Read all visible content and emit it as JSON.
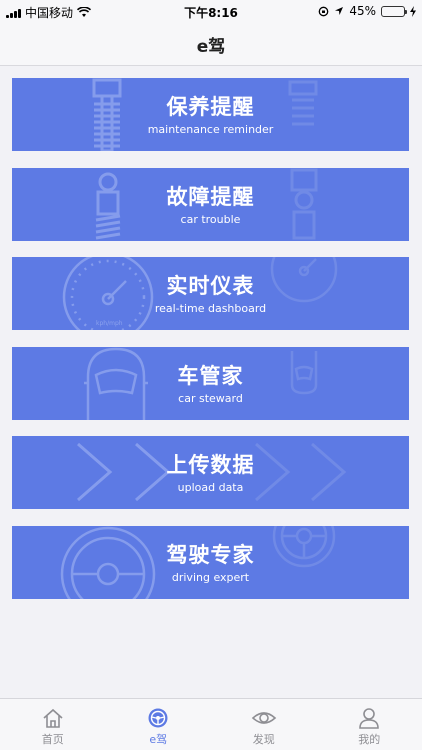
{
  "status_bar": {
    "carrier": "中国移动",
    "time": "下午8:16",
    "battery_text": "45%",
    "battery_level": 0.45
  },
  "nav": {
    "title": "e驾"
  },
  "cards": [
    {
      "title": "保养提醒",
      "subtitle": "maintenance reminder"
    },
    {
      "title": "故障提醒",
      "subtitle": "car trouble"
    },
    {
      "title": "实时仪表",
      "subtitle": "real-time dashboard"
    },
    {
      "title": "车管家",
      "subtitle": "car steward"
    },
    {
      "title": "上传数据",
      "subtitle": "upload data"
    },
    {
      "title": "驾驶专家",
      "subtitle": "driving expert"
    }
  ],
  "gauge_text": "kph/mph",
  "tabs": [
    {
      "label": "首页",
      "icon": "home-icon"
    },
    {
      "label": "e驾",
      "icon": "steering-wheel-icon"
    },
    {
      "label": "发现",
      "icon": "eye-icon"
    },
    {
      "label": "我的",
      "icon": "user-icon"
    }
  ],
  "colors": {
    "card": "#5d7ae4",
    "active": "#5d7ae4",
    "inactive": "#8e8e93"
  }
}
